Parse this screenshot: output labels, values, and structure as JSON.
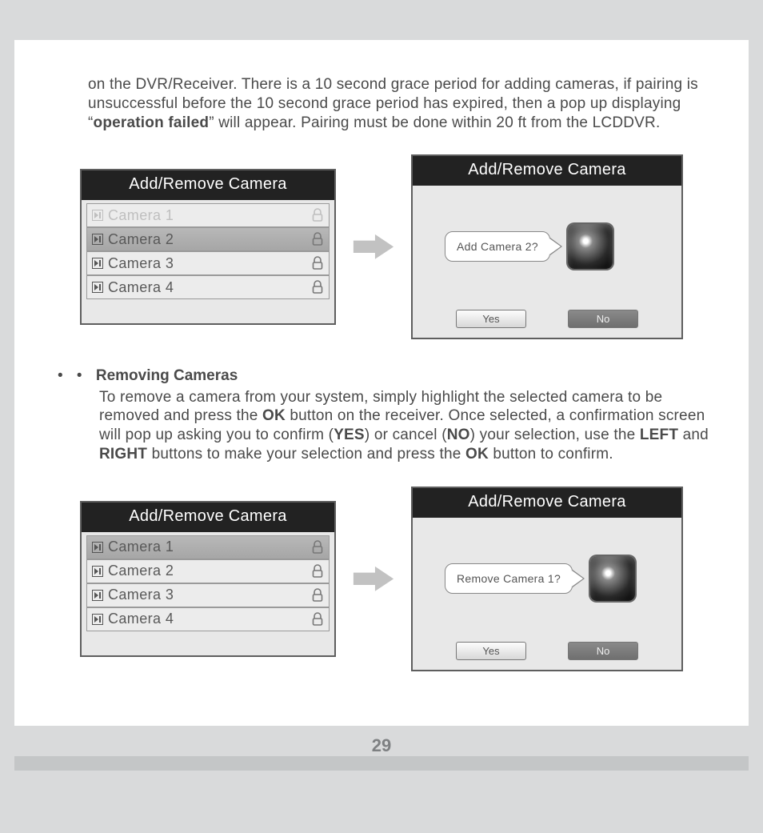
{
  "paragraph1": {
    "p1a": "on the DVR/Receiver. There is a 10 second grace period for adding cameras, if pairing is unsuccessful before the 10 second grace period has expired, then a pop up displaying “",
    "p1b": "operation failed",
    "p1c": "” will appear. Pairing must be done within 20 ft from the LCDDVR."
  },
  "panels": {
    "header": "Add/Remove Camera",
    "cameras": [
      "Camera 1",
      "Camera 2",
      "Camera 3",
      "Camera 4"
    ]
  },
  "dialog_add": {
    "prompt": "Add  Camera 2?",
    "yes": "Yes",
    "no": "No"
  },
  "dialog_remove": {
    "prompt": "Remove  Camera 1?",
    "yes": "Yes",
    "no": "No"
  },
  "section2": {
    "bullet_prefix": "• • ",
    "title": "Removing Cameras",
    "t1": "To remove a camera from your system, simply highlight the selected camera to be removed and press the ",
    "ok1": "OK",
    "t2": " button on the receiver. Once selected, a confirmation screen will pop up asking you to confirm (",
    "yes": "YES",
    "t3": ") or cancel (",
    "no": "NO",
    "t4": ") your selection, use the ",
    "left": "LEFT",
    "t5": " and ",
    "right": "RIGHT",
    "t6": " buttons to make your selection and press the ",
    "ok2": "OK",
    "t7": " button to confirm."
  },
  "page_number": "29"
}
